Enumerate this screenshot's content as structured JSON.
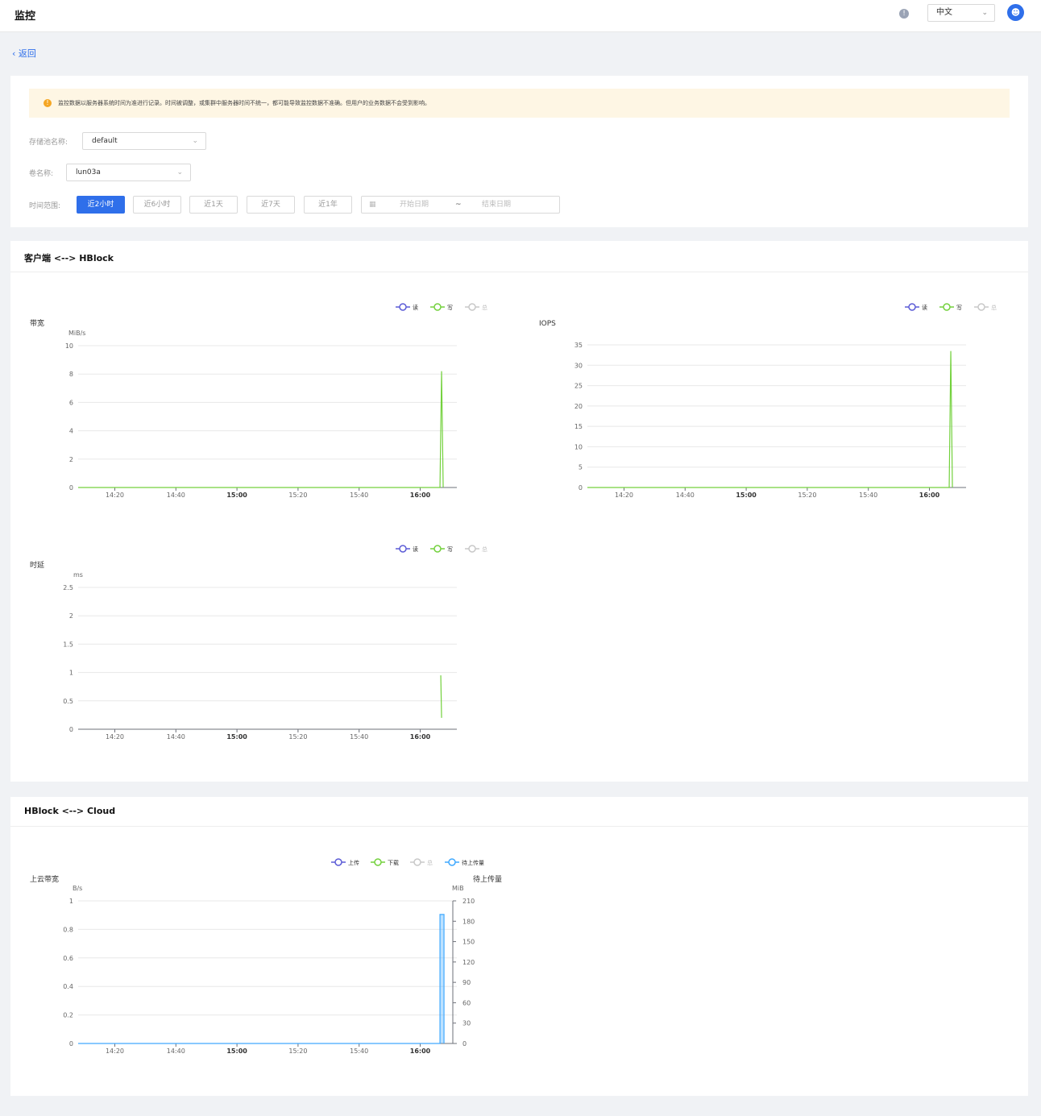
{
  "header": {
    "title": "监控",
    "language": "中文"
  },
  "nav": {
    "back_label": "返回"
  },
  "alert": {
    "text": "监控数据以服务器系统时间为准进行记录。时间被调整，或集群中服务器时间不统一，都可能导致监控数据不准确。但用户的业务数据不会受到影响。"
  },
  "filters": {
    "pool_label": "存储池名称:",
    "pool_value": "default",
    "volume_label": "卷名称:",
    "volume_value": "lun03a",
    "time_label": "时间范围:",
    "time_buttons": [
      "近2小时",
      "近6小时",
      "近1天",
      "近7天",
      "近1年"
    ],
    "start_placeholder": "开始日期",
    "tilde": "~",
    "end_placeholder": "结束日期"
  },
  "sections": {
    "client": "客户端 <--> HBlock",
    "cloud": "HBlock <--> Cloud"
  },
  "colors": {
    "read": "#5b5bd6",
    "write": "#73d13d",
    "sum": "#c8c8c8",
    "pending": "#40a9ff",
    "primary": "#2f6fea"
  },
  "chart_data": [
    {
      "type": "line",
      "title": "带宽",
      "ylabel": "MiB/s",
      "x_ticks": [
        "14:20",
        "14:40",
        "15:00",
        "15:20",
        "15:40",
        "16:00"
      ],
      "x_bold": [
        "15:00",
        "16:00"
      ],
      "legend": [
        "读",
        "写",
        "总"
      ],
      "ylim": [
        0,
        10
      ],
      "yticks": [
        "0",
        "2",
        "4",
        "6",
        "8",
        "10"
      ],
      "series": [
        {
          "name": "写",
          "spike": 8.2
        }
      ]
    },
    {
      "type": "line",
      "title": "IOPS",
      "ylabel": "",
      "x_ticks": [
        "14:20",
        "14:40",
        "15:00",
        "15:20",
        "15:40",
        "16:00"
      ],
      "x_bold": [
        "15:00",
        "16:00"
      ],
      "legend": [
        "读",
        "写",
        "总"
      ],
      "ylim": [
        0,
        35
      ],
      "yticks": [
        "0",
        "5",
        "10",
        "15",
        "20",
        "25",
        "30",
        "35"
      ],
      "series": [
        {
          "name": "写",
          "spike": 33.5
        }
      ]
    },
    {
      "type": "line",
      "title": "时延",
      "ylabel": "ms",
      "x_ticks": [
        "14:20",
        "14:40",
        "15:00",
        "15:20",
        "15:40",
        "16:00"
      ],
      "x_bold": [
        "15:00",
        "16:00"
      ],
      "legend": [
        "读",
        "写",
        "总"
      ],
      "ylim": [
        0,
        2.5
      ],
      "yticks": [
        "0",
        "0.5",
        "1",
        "1.5",
        "2",
        "2.5"
      ],
      "series": [
        {
          "name": "写",
          "values": [
            0.95,
            0.2
          ]
        }
      ]
    },
    {
      "type": "area",
      "title": "上云带宽",
      "ylabel": "B/s",
      "y2title": "待上传量",
      "y2label": "MiB",
      "x_ticks": [
        "14:20",
        "14:40",
        "15:00",
        "15:20",
        "15:40",
        "16:00"
      ],
      "x_bold": [
        "15:00",
        "16:00"
      ],
      "legend": [
        "上传",
        "下载",
        "总",
        "待上传量"
      ],
      "ylim": [
        0,
        1
      ],
      "yticks": [
        "0",
        "0.2",
        "0.4",
        "0.6",
        "0.8",
        "1"
      ],
      "y2ticks": [
        "0",
        "30",
        "60",
        "90",
        "120",
        "150",
        "180",
        "210"
      ],
      "series": [
        {
          "name": "待上传量",
          "spike": 190
        }
      ]
    }
  ]
}
